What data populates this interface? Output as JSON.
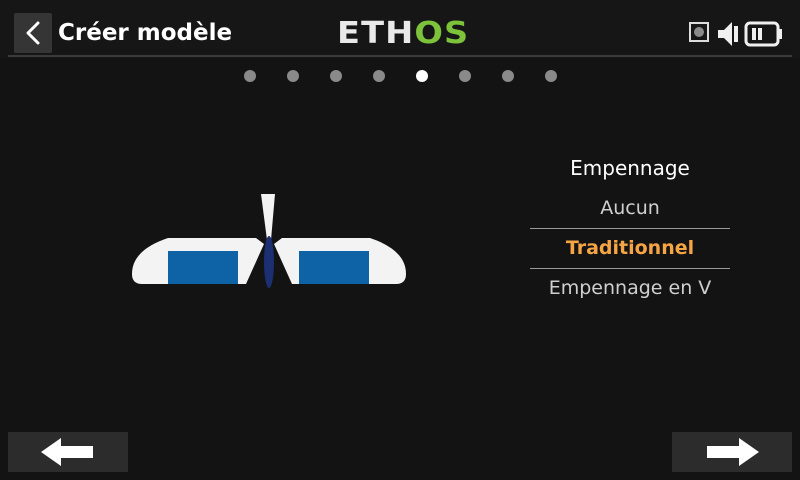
{
  "header": {
    "title": "Créer modèle",
    "logo_left": "ETH",
    "logo_right": "OS",
    "logo_colors": {
      "white": "#e9e9e9",
      "green": "#7cc23a"
    },
    "icons": [
      "chevron-left-icon",
      "storage-indicator-icon",
      "speaker-icon",
      "battery-icon"
    ]
  },
  "pager": {
    "total_pages": 8,
    "current_page": 5
  },
  "illustration": {
    "name": "plane-tail-diagram",
    "colors": {
      "surface": "#f3f3f3",
      "control_surface": "#0e63a6",
      "fin": "#1c2f73"
    }
  },
  "tail_selector": {
    "heading": "Empennage",
    "options": [
      {
        "label": "Aucun",
        "selected": false
      },
      {
        "label": "Traditionnel",
        "selected": true
      },
      {
        "label": "Empennage en V",
        "selected": false
      }
    ],
    "selected_color": "#f6a545"
  },
  "footer": {
    "prev_icon": "arrow-left-icon",
    "next_icon": "arrow-right-icon"
  }
}
